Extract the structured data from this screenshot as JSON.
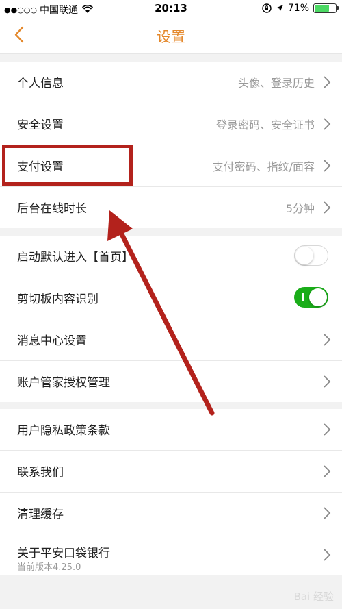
{
  "status_bar": {
    "signal": "●●○○○",
    "carrier": "中国联通",
    "time": "20:13",
    "battery_percent": "71%",
    "battery_level": 0.71
  },
  "nav": {
    "title": "设置"
  },
  "groups": {
    "account": [
      {
        "label": "个人信息",
        "value": "头像、登录历史"
      },
      {
        "label": "安全设置",
        "value": "登录密码、安全证书"
      },
      {
        "label": "支付设置",
        "value": "支付密码、指纹/面容"
      },
      {
        "label": "后台在线时长",
        "value": "5分钟"
      }
    ],
    "prefs": [
      {
        "label": "启动默认进入【首页】",
        "toggle": false
      },
      {
        "label": "剪切板内容识别",
        "toggle": true
      },
      {
        "label": "消息中心设置"
      },
      {
        "label": "账户管家授权管理"
      }
    ],
    "about": [
      {
        "label": "用户隐私政策条款"
      },
      {
        "label": "联系我们"
      },
      {
        "label": "清理缓存"
      },
      {
        "label": "关于平安口袋银行",
        "sub": "当前版本4.25.0"
      }
    ]
  },
  "colors": {
    "accent": "#e4882b",
    "toggle_on": "#1aad19",
    "annotation": "#b3221c"
  },
  "watermark": "Bai 经验"
}
